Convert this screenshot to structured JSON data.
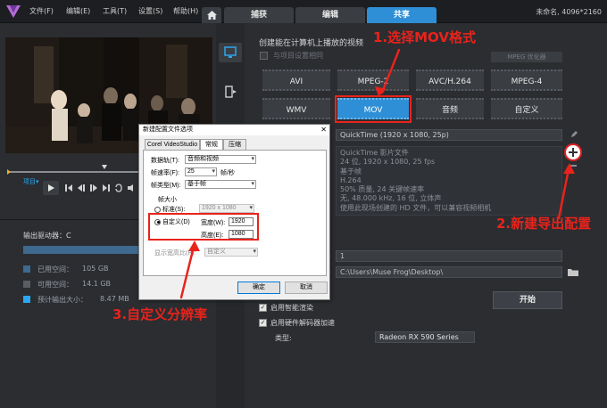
{
  "menu": {
    "items": [
      "文件(F)",
      "编辑(E)",
      "工具(T)",
      "设置(S)",
      "帮助(H)"
    ]
  },
  "tabs": [
    "捕获",
    "编辑",
    "共享"
  ],
  "project_info": "未命名, 4096*2160",
  "left": {
    "project_label": "项目▾",
    "drive_label": "输出驱动器：C",
    "stats": [
      {
        "label": "已用空间：",
        "value": "105 GB",
        "color": "#3e6a8f"
      },
      {
        "label": "可用空间：",
        "value": "14.1 GB",
        "color": "#5a5d62"
      },
      {
        "label": "预计输出大小：",
        "value": "8.47 MB",
        "color": "#2aa7f0"
      }
    ]
  },
  "right": {
    "heading": "创建能在计算机上播放的视频",
    "same_as_project": "与项目设置相同",
    "mpeg_optimizer": "MPEG 优化器",
    "formats": [
      "AVI",
      "MPEG-2",
      "AVC/H.264",
      "MPEG-4",
      "WMV",
      "MOV",
      "音频",
      "自定义"
    ],
    "selected_format": "MOV",
    "profile": "QuickTime (1920 x 1080, 25p)",
    "profile_info": [
      "QuickTime 影片文件",
      "24 位, 1920 x 1080, 25 fps",
      "基于帧",
      "H.264",
      "50% 质量, 24 关键帧速率",
      "无, 48.000 kHz, 16 位, 立体声",
      "使用此现场创建的 HD 文件，可以兼容视频相机"
    ],
    "file_name": "1",
    "file_path": "C:\\Users\\Muse Frog\\Desktop\\",
    "start_label": "开始",
    "smart_render": "启用智能渲染",
    "hw_accel": "启用硬件解码器加速",
    "type_label": "类型:",
    "gpu": "Radeon RX 590 Series"
  },
  "dialog": {
    "title": "新建配置文件选项",
    "close": "✕",
    "tabs": [
      "Corel VideoStudio",
      "常规",
      "压缩"
    ],
    "track_label": "数据轨(T):",
    "track_value": "音频和视频",
    "fps_label": "帧速率(F):",
    "fps_value": "25",
    "fps_unit": "帧/秒",
    "frame_type_label": "帧类型(M):",
    "frame_type_value": "基于帧",
    "frame_size_label": "帧大小",
    "standard_label": "标准(S):",
    "standard_value": "1920 x 1080",
    "custom_label": "自定义(D)",
    "width_label": "宽度(W):",
    "width_value": "1920",
    "height_label": "高度(E):",
    "height_value": "1080",
    "aspect_label": "显示宽高比(P):",
    "aspect_value": "自定义",
    "ok": "确定",
    "cancel": "取消"
  },
  "annotations": {
    "step1": "1.选择MOV格式",
    "step2": "2.新建导出配置",
    "step3": "3.自定义分辨率"
  },
  "colors": {
    "accent": "#2e8fd6",
    "annotation": "#e8231c"
  }
}
